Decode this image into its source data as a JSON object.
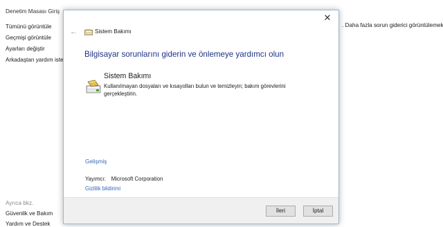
{
  "background": {
    "home_link": "Denetim Masası Giriş",
    "sidebar": [
      {
        "label": "Tümünü görüntüle"
      },
      {
        "label": "Geçmişi görüntüle"
      },
      {
        "label": "Ayarları değiştir"
      },
      {
        "label": "Arkadaştan yardım iste"
      }
    ],
    "truncated_text": ". Daha fazla sorun giderici görüntülemek i",
    "see_also_label": "Ayrıca bkz.",
    "see_also": [
      {
        "label": "Güvenlik ve Bakım"
      },
      {
        "label": "Yardım ve Destek"
      }
    ]
  },
  "dialog": {
    "title": "Sistem Bakımı",
    "close_glyph": "✕",
    "back_glyph": "←",
    "heading": "Bilgisayar sorunlarını giderin ve önlemeye yardımcı olun",
    "tool_name": "Sistem Bakımı",
    "tool_description": "Kullanılmayan dosyaları ve kısayolları bulun ve temizleyin; bakım görevlerini gerçekleştirin.",
    "advanced_link": "Gelişmiş",
    "publisher_label": "Yayımcı:",
    "publisher_value": "Microsoft Corporation",
    "privacy_link": "Gizlilik bildirimi",
    "next_button": "İleri",
    "cancel_button": "İptal"
  },
  "icons": {
    "title_icon": "maintenance-icon",
    "tool_icon": "maintenance-icon",
    "accent_color": "#1e3287",
    "link_color": "#3366bb"
  }
}
